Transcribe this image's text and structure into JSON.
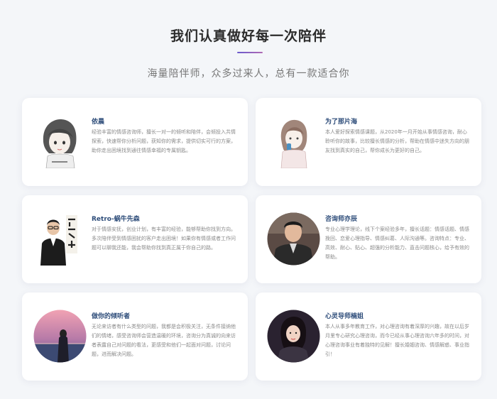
{
  "header": {
    "title": "我们认真做好每一次陪伴",
    "subtitle": "海量陪伴师，众多过来人，总有一款适合你"
  },
  "colors": {
    "accent_gradient_start": "#6a5acd",
    "accent_gradient_end": "#b06ab3",
    "name_color": "#2e4d7a",
    "desc_color": "#8a8a8a",
    "background": "#f4f6f9"
  },
  "counselors": [
    {
      "name": "依晨",
      "avatar": "sketch-girl-short-hair",
      "desc": "经验丰富的情感咨询师，擅长一对一的倾听和陪伴，会倾投入共情探索，快速帮你分析问题，获知你的需求，提供切实可行的方案，助你走出困境找到通往情感幸福的专属钥匙。"
    },
    {
      "name": "为了那片海",
      "avatar": "sketch-girl-phone",
      "desc": "本人爱好探索情感课题，从2020年一月开始从事情感咨询，耐心聆听你的故事，比较擅长情感的分析，帮助在情感中迷失方向的朋友找到真实的自己，帮你成长为更好的自己。"
    },
    {
      "name": "Retro-蜗牛先森",
      "avatar": "man-photo-calligraphy",
      "desc": "对于情感安抚，创业计划，有丰富的经验，能够帮助你找到方向。多次陪伴受到情感困扰的客户走出困境！如果你有情感或者工作问题可以聊我还能，我会帮助你找到真正属于你自己的路。"
    },
    {
      "name": "咨询师亦辰",
      "avatar": "man-photo-circle",
      "desc": "专业心理学理论，线下个案经验多年，擅长话题：情感话题、情感挽回、恋爱心理指导、情感纠葛、人际沟通等。咨询特点：专业、高效、耐心、贴心、超强的分析能力、直击问题核心，给予有效的帮助。"
    },
    {
      "name": "做你的倾听者",
      "avatar": "sunset-silhouette",
      "desc": "无论来访者有什么类型的问题，我都是会积极关注，无条件接纳他们的情绪，感受咨询师会营造温暖的环境，咨询分为真诚的向来访者表露自己对问题的看法，更感受和他们一起面对问题，讨论问题，进而解决问题。"
    },
    {
      "name": "心灵导师楠姐",
      "avatar": "woman-photo-circle",
      "desc": "本人从事多年教育工作，对心理咨询有着深厚的兴趣，故在以后岁月里专心研究心理咨询，而今已经从事心理咨询六年多的时间，对心理咨询事业有着独特的见解！擅长婚姻咨询、情感解惑、事业指引！"
    }
  ]
}
